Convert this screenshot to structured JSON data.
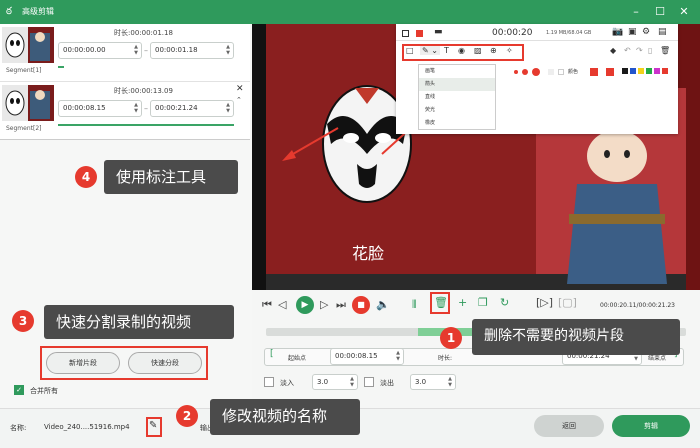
{
  "app": {
    "title": "高级剪辑"
  },
  "segments": [
    {
      "label": "Segment[1]",
      "duration_label": "时长:",
      "duration": "00:00:01.18",
      "start": "00:00:00.00",
      "end": "00:00:01.18"
    },
    {
      "label": "Segment[2]",
      "duration_label": "时长:",
      "duration": "00:00:13.09",
      "start": "00:00:08.15",
      "end": "00:00:21.24"
    }
  ],
  "annotations": {
    "a1": {
      "num": "1",
      "text": "删除不需要的视频片段"
    },
    "a2": {
      "num": "2",
      "text": "修改视频的名称"
    },
    "a3": {
      "num": "3",
      "text": "快速分割录制的视频"
    },
    "a4": {
      "num": "4",
      "text": "使用标注工具"
    }
  },
  "left_buttons": {
    "new_segment": "新增片段",
    "quick_split": "快速分段"
  },
  "merge_all": "合并所有",
  "video": {
    "caption": "花脸"
  },
  "annot_toolbar": {
    "timer": "00:00:20",
    "size": "1.19 MB/68.04 GB",
    "menu": [
      "画笔",
      "箭头",
      "直线",
      "荧光",
      "橡皮"
    ],
    "color_label": "颜色"
  },
  "controls": {
    "time_display": "00:00:20.11/00:00:21.23",
    "start_btn": "起始点",
    "start_val": "00:00:08.15",
    "dur_label": "时长:",
    "end_val": "00:00:21.24",
    "end_btn": "结束点",
    "fadein_label": "淡入",
    "fadein_val": "3.0",
    "fadeout_label": "淡出",
    "fadeout_val": "3.0"
  },
  "footer": {
    "name_label": "名称:",
    "name_value": "Video_240....51916.mp4",
    "output_label": "输出",
    "back": "返回",
    "save": "剪辑"
  },
  "colors": {
    "accent": "#2f9a5c",
    "annotation_red": "#e63a2e"
  }
}
